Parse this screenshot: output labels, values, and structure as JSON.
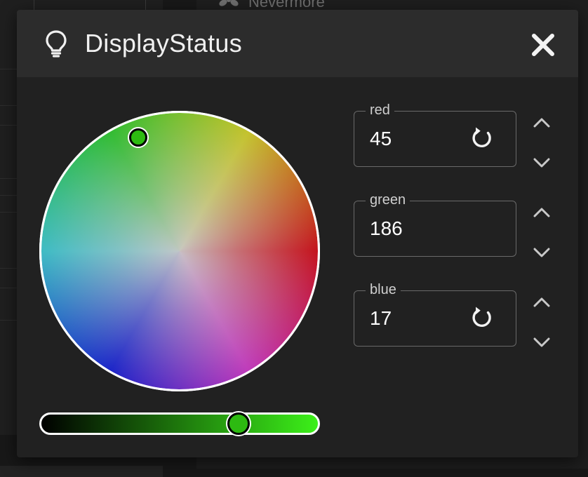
{
  "background": {
    "top_label": "Nevermore"
  },
  "dialog": {
    "title": "DisplayStatus",
    "header_icon": "lightbulb-icon",
    "close_icon": "close-icon"
  },
  "color": {
    "red": 45,
    "green": 186,
    "blue": 17,
    "hex": "#2dba11",
    "brightness_fraction": 0.71
  },
  "fields": [
    {
      "key": "red",
      "label": "red",
      "value": "45",
      "show_reset": true
    },
    {
      "key": "green",
      "label": "green",
      "value": "186",
      "show_reset": false
    },
    {
      "key": "blue",
      "label": "blue",
      "value": "17",
      "show_reset": true
    }
  ],
  "colors": {
    "dialog_bg": "#212121",
    "header_bg": "#2c2c2c",
    "text": "#ffffff",
    "field_border": "#6a6a6a",
    "slider_start": "#000000",
    "slider_end": "#3cf019"
  }
}
